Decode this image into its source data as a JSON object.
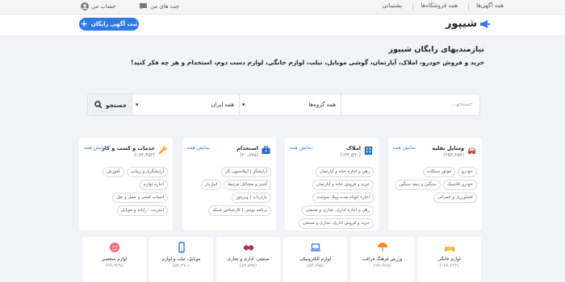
{
  "topbar": {
    "all_ads": "همه آگهی‌ها",
    "all_stores": "همه فروشگاه‌ها",
    "support": "پشتیبانی",
    "my_chats": "چت های من",
    "my_account": "حساب من"
  },
  "header": {
    "logo": "شیپور",
    "post_ad": "ثبت آگهی رایگان"
  },
  "hero": {
    "title": "نیازمندیهای رایگان شیپور",
    "subtitle": "خرید و فروش خودرو، املاک، آپارتمان، گوشی موبایل، تبلت، لوازم خانگی، لوازم دست دوم، استخدام و هر چه فکر کنید!"
  },
  "search": {
    "placeholder": "جستجو...",
    "category": "همه گروه‌ها",
    "region": "همه ایران",
    "button": "جستجو"
  },
  "categories": [
    {
      "title": "وسایل نقلیه",
      "count": "(۶۵۳,۶۵۷)",
      "show_all": "نمایش همه",
      "tags": [
        "خودرو",
        "موتور سیکلت",
        "خودرو کلاسیک",
        "سنگین و نیمه سنگین",
        "کشاورزی و عمرانی"
      ]
    },
    {
      "title": "املاک",
      "count": "(۱۳۲,۵۹۰)",
      "show_all": "نمایش همه",
      "tags": [
        "رهن و اجاره خانه و آپارتمان",
        "خرید و فروش خانه و آپارتمان",
        "اجاره کوتاه مدت ویلا، سوئیت",
        "رهن و اجاره اداری، تجاری و صنعتی",
        "خرید و فروش اداری، تجاری و صنعتی"
      ]
    },
    {
      "title": "استخدام",
      "count": "(۲۰,۸۷۵)",
      "show_all": "نمایش همه",
      "tags": [
        "آرایشگر | اپیلاسیون کار",
        "آشپز و مشاغل مرتبط",
        "انباردار",
        "بازاریاب | ویزیتور",
        "برنامه نویس | کارشناس شبکه"
      ]
    },
    {
      "title": "خدمات و کسب و کار",
      "count": "(۱۶۳,۴۵۳)",
      "show_all": "نمایش همه",
      "tags": [
        "آرایشگری و زیبایی",
        "آموزش",
        "اجاره لوازم",
        "اسباب کشی و حمل و نقل",
        "اینترنت ، رایانه و موبایل"
      ]
    }
  ],
  "small_categories": [
    {
      "name": "لوازم خانگی",
      "count": "(۱۷۸,۶۳۲)"
    },
    {
      "name": "ورزش فرهنگ فراغت",
      "count": "(۹۷,۹۶۵)"
    },
    {
      "name": "لوازم الکترونیکی",
      "count": "(۵۳,۶۹۵)"
    },
    {
      "name": "صنعتی، اداری و تجاری",
      "count": "(۸۳,۵۹۷)"
    },
    {
      "name": "موبایل، تبلت و لوازم",
      "count": "(۵۳,۲۷۰)"
    },
    {
      "name": "لوازم شخصی",
      "count": "(۹۹,۹۳۹)"
    }
  ],
  "colors": {
    "accent": "#2f7be5",
    "vehicle": "#e84f4f",
    "estate": "#1a6fb0",
    "job": "#2b6cc4",
    "service": "#f3a722"
  }
}
